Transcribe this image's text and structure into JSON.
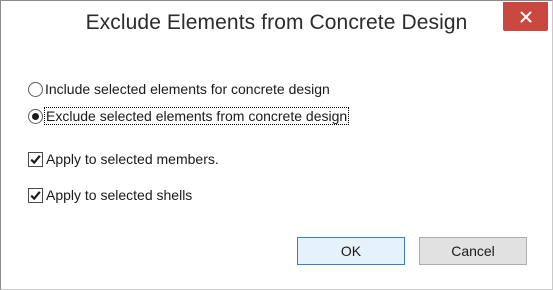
{
  "dialog": {
    "title": "Exclude Elements from Concrete Design",
    "close_glyph": "✕"
  },
  "options": {
    "include_label": "Include selected elements for concrete design",
    "include_selected": false,
    "exclude_label": "Exclude selected elements from concrete design",
    "exclude_selected": true
  },
  "apply": {
    "members_label": "Apply to selected members.",
    "members_checked": true,
    "shells_label": "Apply to selected shells",
    "shells_checked": true
  },
  "buttons": {
    "ok_label": "OK",
    "cancel_label": "Cancel"
  },
  "colors": {
    "close_button": "#c9483f",
    "default_button_border": "#3c7fb1"
  },
  "icons": {
    "close": "close-icon",
    "checkmark": "checkmark-icon"
  }
}
